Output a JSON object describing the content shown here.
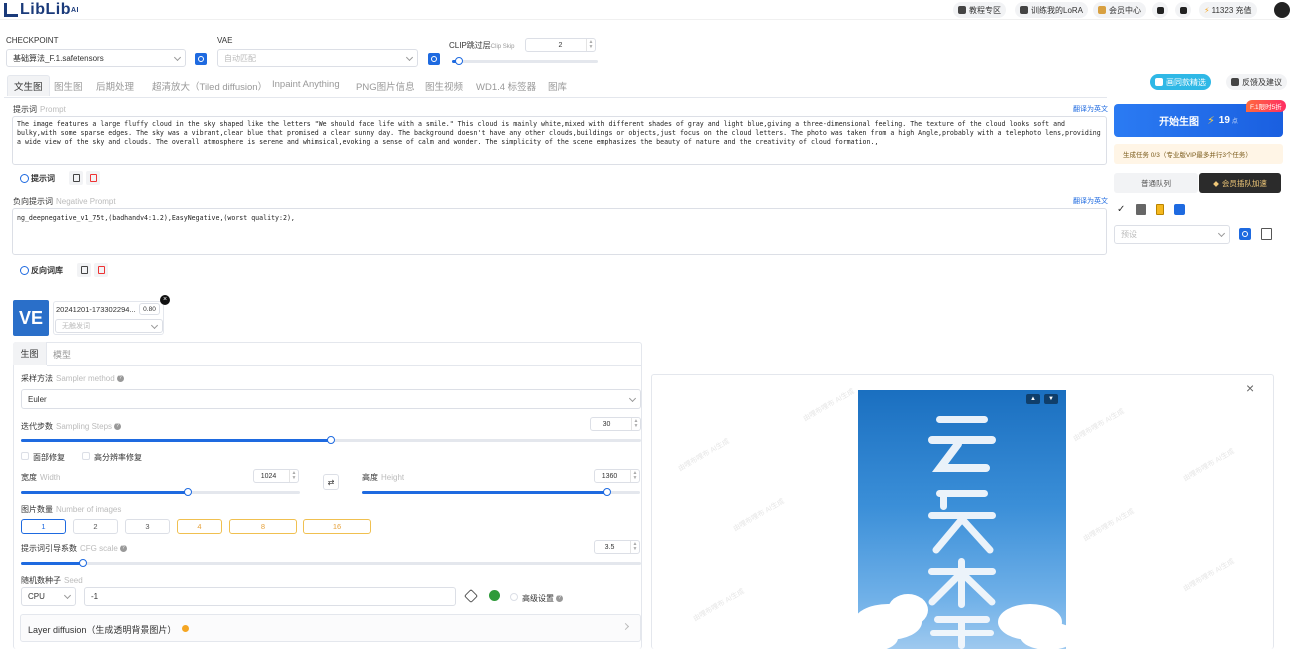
{
  "topbar": {
    "logo": "LibLib",
    "logo_sup": "AI",
    "tutorial": "教程专区",
    "train_lora": "训练我的LoRA",
    "vip_center": "会员中心",
    "credits": "11323",
    "recharge": "充值"
  },
  "checkpoint": {
    "label": "CHECKPOINT",
    "value": "基础算法_F.1.safetensors"
  },
  "vae": {
    "label": "VAE",
    "placeholder": "自动匹配"
  },
  "clip": {
    "label": "CLIP跳过层",
    "sub": "Clip Skip",
    "value": "2",
    "fraction": 0.05
  },
  "tabs": [
    "文生图",
    "图生图",
    "后期处理",
    "超清放大（Tiled diffusion）",
    "Inpaint Anything",
    "PNG图片信息",
    "图生视频",
    "WD1.4 标签器",
    "图库"
  ],
  "right_top": {
    "gallery_btn": "画同款精选",
    "feedback_btn": "反馈及建议"
  },
  "prompt": {
    "label": "提示词",
    "sub": "Prompt",
    "translate": "翻译为英文",
    "text": "The image features a large fluffy cloud in the sky shaped like the letters \"We should face life with a smile.\" This cloud is mainly white,mixed with different shades of gray and light blue,giving a three-dimensional feeling. The texture of the cloud looks soft and bulky,with some sparse edges. The sky was a vibrant,clear blue that promised a clear sunny day. The background doesn't have any other clouds,buildings or objects,just focus on the cloud letters. The photo was taken from a high Angle,probably with a telephoto lens,providing a wide view of the sky and clouds. The overall atmosphere is serene and whimsical,evoking a sense of calm and wonder. The simplicity of the scene emphasizes the beauty of nature and the creativity of cloud formation.,",
    "chip": "提示词"
  },
  "negative": {
    "label": "负向提示词",
    "sub": "Negative Prompt",
    "translate": "翻译为英文",
    "text": "ng_deepnegative_v1_75t,(badhandv4:1.2),EasyNegative,(worst quality:2),",
    "chip": "反向词库"
  },
  "generate": {
    "label": "开始生图",
    "cost": "19",
    "cost_unit": "点",
    "promo": "F.1限时5折"
  },
  "queue": {
    "note": "生成任务 0/3（专业版VIP最多并行3个任务）",
    "normal": "普通队列",
    "vip": "会员插队加速"
  },
  "preset": {
    "placeholder": "预设"
  },
  "lora": {
    "name": "20241201-173302294...",
    "weight": "0.80",
    "trigger_placeholder": "无触发词"
  },
  "subtabs": [
    "生图",
    "模型"
  ],
  "sampler": {
    "label": "采样方法",
    "sub": "Sampler method",
    "value": "Euler"
  },
  "steps": {
    "label": "迭代步数",
    "sub": "Sampling Steps",
    "value": "30",
    "fraction": 0.5
  },
  "face_fix": "面部修复",
  "hires_fix": "高分辨率修复",
  "width": {
    "label": "宽度",
    "sub": "Width",
    "value": "1024",
    "fraction": 0.6
  },
  "height": {
    "label": "高度",
    "sub": "Height",
    "value": "1360",
    "fraction": 0.88
  },
  "num_images": {
    "label": "图片数量",
    "sub": "Number of images",
    "options": [
      "1",
      "2",
      "3",
      "4",
      "8",
      "16"
    ]
  },
  "cfg": {
    "label": "提示词引导系数",
    "sub": "CFG scale",
    "value": "3.5",
    "fraction": 0.1
  },
  "seed": {
    "label": "随机数种子",
    "sub": "Seed",
    "device": "CPU",
    "value": "-1",
    "advanced": "高级设置"
  },
  "layer_diffusion": "Layer diffusion（生成透明背景图片）",
  "watermark": "由哩布哩布 AI生成"
}
